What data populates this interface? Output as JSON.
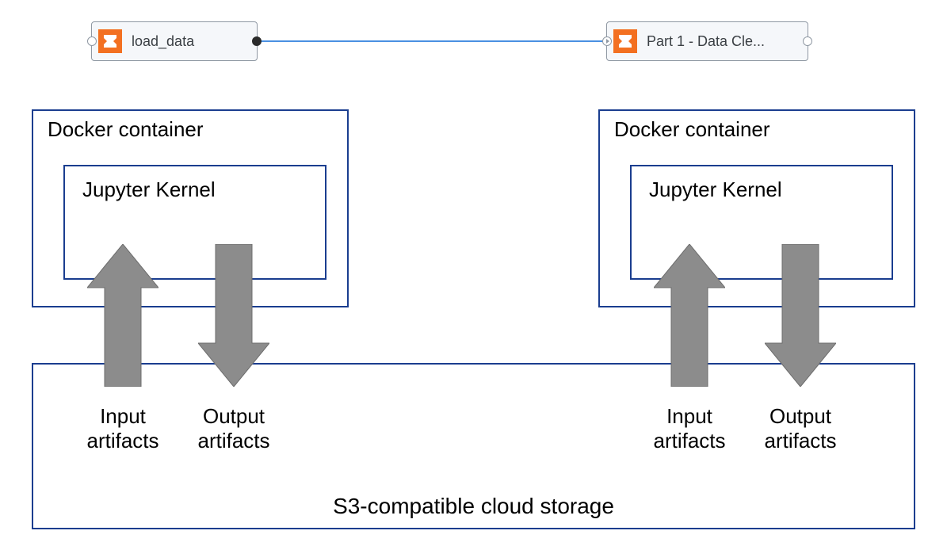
{
  "pipeline": {
    "node1": {
      "label": "load_data"
    },
    "node2": {
      "label": "Part 1 - Data Cle..."
    }
  },
  "containers": {
    "left": {
      "title": "Docker container",
      "kernel": "Jupyter Kernel"
    },
    "right": {
      "title": "Docker container",
      "kernel": "Jupyter Kernel"
    }
  },
  "arrows": {
    "left_in": "Input\nartifacts",
    "left_out": "Output\nartifacts",
    "right_in": "Input\nartifacts",
    "right_out": "Output\nartifacts"
  },
  "storage": {
    "label": "S3-compatible cloud storage"
  }
}
